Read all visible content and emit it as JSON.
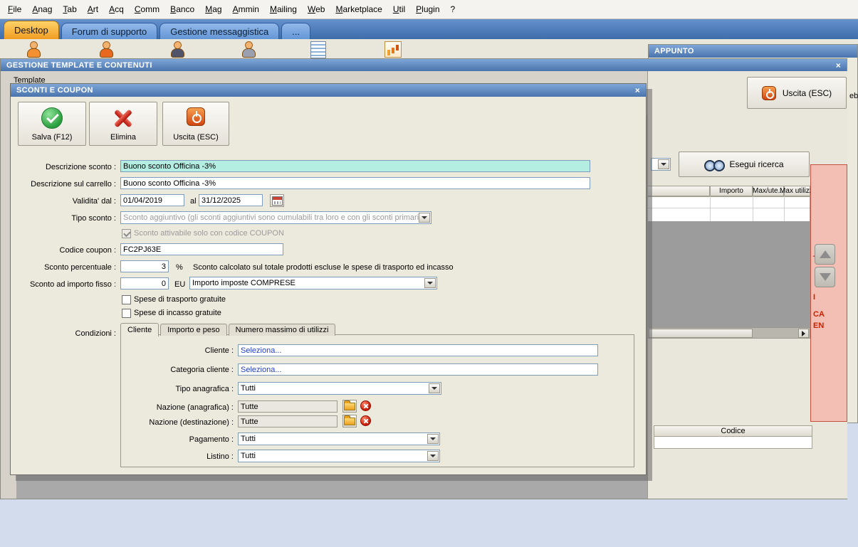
{
  "colors": {
    "titlebar_blue": "#5d87bf",
    "active_tab_orange": "#f09c22",
    "highlight_cyan": "#b4eee2",
    "link_blue": "#2340c8",
    "side_panel_pink": "#f3beb3"
  },
  "icons": {
    "salva": "check-circle",
    "elimina": "x-mark",
    "uscita": "power",
    "calendar": "calendar",
    "folder": "folder",
    "delete": "x-circle",
    "search": "binoculars",
    "combo": "chevron-down"
  },
  "menu": {
    "items": [
      "File",
      "Anag",
      "Tab",
      "Art",
      "Acq",
      "Comm",
      "Banco",
      "Mag",
      "Ammin",
      "Mailing",
      "Web",
      "Marketplace",
      "Util",
      "Plugin",
      "?"
    ]
  },
  "tabbar": {
    "tabs": [
      "Desktop",
      "Forum di supporto",
      "Gestione messaggistica",
      "..."
    ]
  },
  "appunto": {
    "title": "APPUNTO",
    "fragment": "eb"
  },
  "window": {
    "title": "GESTIONE TEMPLATE E CONTENUTI",
    "close": "×",
    "template_label": "Template",
    "uscita_label": "Uscita (ESC)",
    "search_button": "Esegui ricerca",
    "grid": {
      "headers": [
        "Importo",
        "Max/ute...",
        "Max utilizzi"
      ]
    },
    "side_fragments": [
      "T",
      "I",
      "CA",
      "EN"
    ],
    "codice_header": "Codice"
  },
  "dialog": {
    "title": "SCONTI E COUPON",
    "close": "×",
    "toolbar": {
      "salva": "Salva (F12)",
      "elimina": "Elimina",
      "uscita": "Uscita (ESC)"
    },
    "fields": {
      "descrizione_sconto_label": "Descrizione sconto :",
      "descrizione_sconto_value": "Buono sconto Officina -3%",
      "descrizione_carrello_label": "Descrizione sul carrello :",
      "descrizione_carrello_value": "Buono sconto Officina -3%",
      "validita_label": "Validita' dal :",
      "validita_dal_value": "01/04/2019",
      "al_label": "al",
      "validita_al_value": "31/12/2025",
      "tipo_sconto_label": "Tipo sconto :",
      "tipo_sconto_value": "Sconto aggiuntivo (gli sconti aggiuntivi sono cumulabili tra loro e con gli sconti primari)",
      "coupon_checkbox_label": "Sconto attivabile solo con codice COUPON",
      "coupon_checkbox_checked": true,
      "codice_coupon_label": "Codice coupon :",
      "codice_coupon_value": "FC2PJ63E",
      "sconto_percentuale_label": "Sconto percentuale :",
      "sconto_percentuale_value": "3",
      "percent_symbol": "%",
      "sconto_percentuale_note": "Sconto calcolato sul totale prodotti escluse le spese di trasporto ed incasso",
      "sconto_importo_label": "Sconto ad importo fisso :",
      "sconto_importo_value": "0",
      "valuta_label": "EU",
      "importo_imposte_value": "Importo imposte COMPRESE",
      "trasporto_checkbox_label": "Spese di trasporto gratuite",
      "trasporto_checkbox_checked": false,
      "incasso_checkbox_label": "Spese di incasso gratuite",
      "incasso_checkbox_checked": false,
      "condizioni_label": "Condizioni :"
    },
    "tabs": [
      "Cliente",
      "Importo e peso",
      "Numero massimo di utilizzi"
    ],
    "cliente_tab": {
      "cliente_label": "Cliente :",
      "cliente_value": "Seleziona...",
      "categoria_label": "Categoria cliente :",
      "categoria_value": "Seleziona...",
      "tipo_anagrafica_label": "Tipo anagrafica :",
      "tipo_anagrafica_value": "Tutti",
      "nazione_anagrafica_label": "Nazione (anagrafica) :",
      "nazione_anagrafica_value": "Tutte",
      "nazione_destinazione_label": "Nazione (destinazione) :",
      "nazione_destinazione_value": "Tutte",
      "pagamento_label": "Pagamento :",
      "pagamento_value": "Tutti",
      "listino_label": "Listino :",
      "listino_value": "Tutti"
    }
  }
}
